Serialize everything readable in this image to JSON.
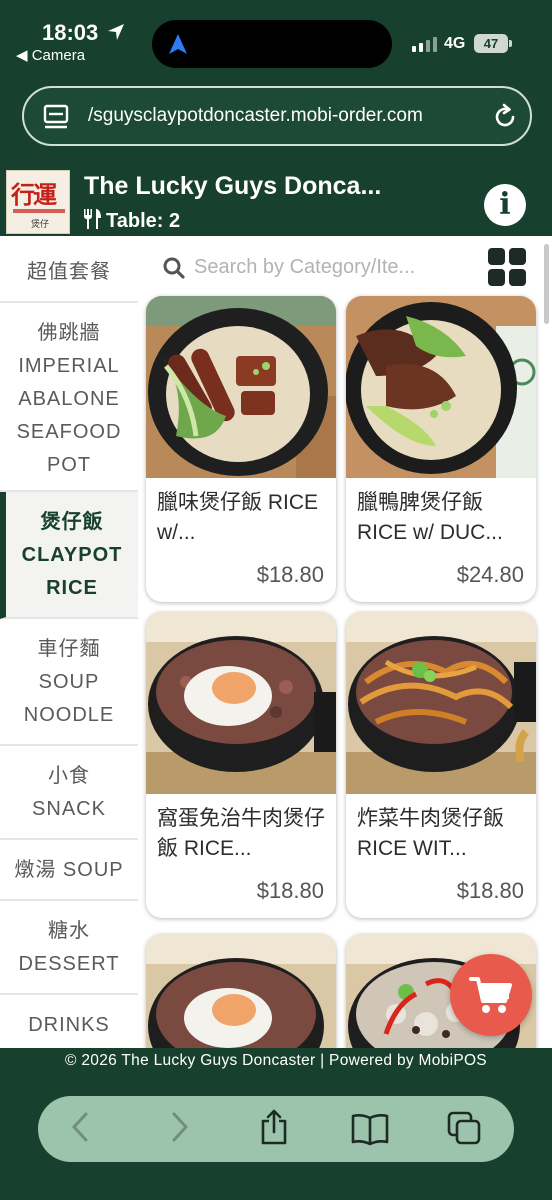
{
  "status_bar": {
    "time": "18:03",
    "back_app": "◀ Camera",
    "network": "4G",
    "battery": "47"
  },
  "browser": {
    "url": "/sguysclaypotdoncaster.mobi-order.com"
  },
  "restaurant": {
    "name": "The Lucky Guys Donca...",
    "table": "Table: 2",
    "logo_text": "行運"
  },
  "sidebar": {
    "items": [
      {
        "zh": "超值套餐",
        "en": "",
        "active": false
      },
      {
        "zh": "佛跳牆",
        "en": "IMPERIAL\nABALONE\nSEAFOOD\nPOT",
        "active": false
      },
      {
        "zh": "煲仔飯",
        "en": "CLAYPOT\nRICE",
        "active": true
      },
      {
        "zh": "車仔麵",
        "en": "SOUP\nNOODLE",
        "active": false
      },
      {
        "zh": "小食",
        "en": "SNACK",
        "active": false
      },
      {
        "zh": "燉湯 SOUP",
        "en": "",
        "active": false
      },
      {
        "zh": "糖水",
        "en": "DESSERT",
        "active": false
      },
      {
        "zh": "DRINKS",
        "en": "",
        "active": false
      }
    ]
  },
  "search": {
    "placeholder": "Search by Category/Ite..."
  },
  "products": [
    {
      "name": "臘味煲仔飯 RICE w/...",
      "price": "$18.80"
    },
    {
      "name": "臘鴨脾煲仔飯 RICE w/ DUC...",
      "price": "$24.80"
    },
    {
      "name": "窩蛋免治牛肉煲仔飯 RICE...",
      "price": "$18.80"
    },
    {
      "name": "炸菜牛肉煲仔飯 RICE WIT...",
      "price": "$18.80"
    }
  ],
  "footer": {
    "text": "© 2026 The Lucky Guys Doncaster | Powered by MobiPOS"
  },
  "colors": {
    "brand_green": "#17402f",
    "cart_red": "#e85a4b"
  }
}
